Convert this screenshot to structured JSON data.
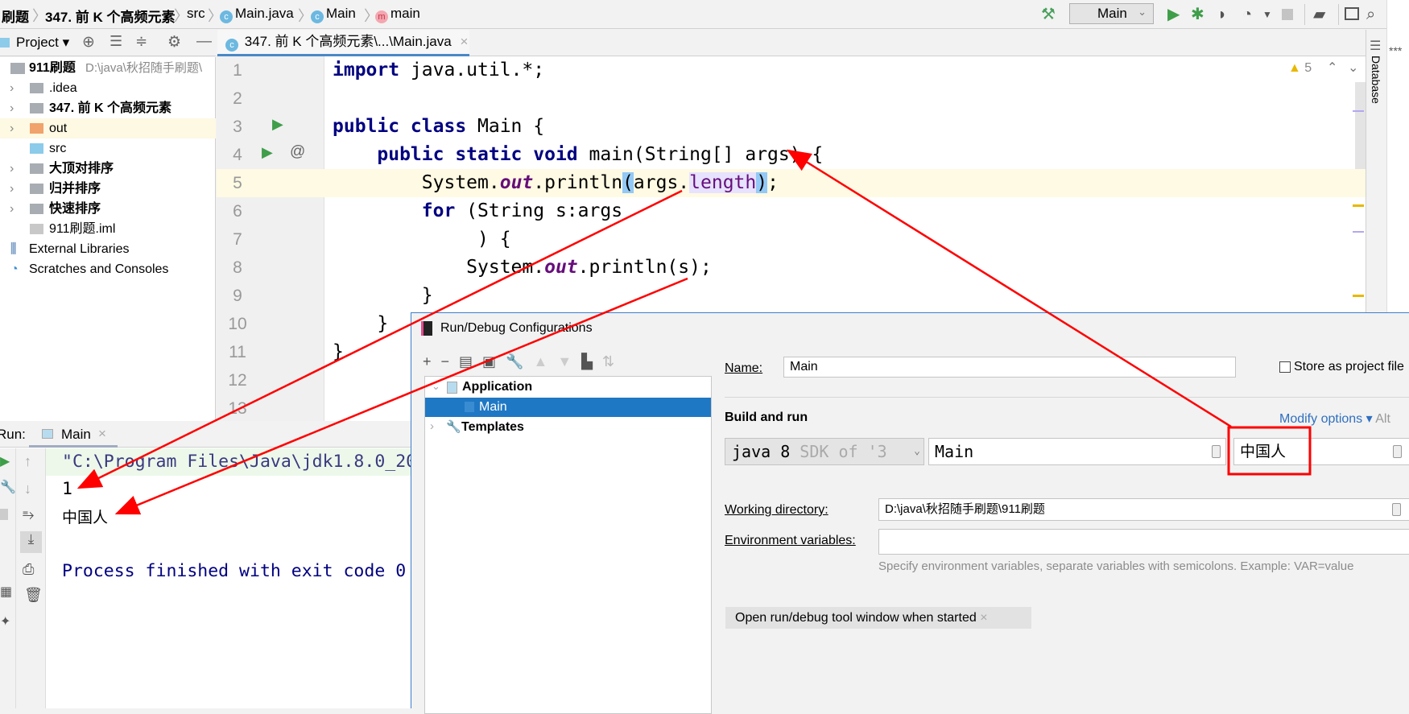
{
  "breadcrumb": {
    "items": [
      "刷题",
      "347. 前 K 个高频元素",
      "src",
      "Main.java",
      "Main",
      "main"
    ]
  },
  "toolbar": {
    "run_config": "Main",
    "icons": [
      "build-hammer-icon",
      "run-icon",
      "debug-icon",
      "coverage-icon",
      "profile-icon",
      "dropdown-icon",
      "stop-icon",
      "project-structure-icon",
      "terminal-icon",
      "search-icon"
    ]
  },
  "project_panel": {
    "title": "Project",
    "root": {
      "name": "911刷题",
      "path": "D:\\java\\秋招随手刷题\\"
    },
    "items": [
      {
        "label": ".idea",
        "bold": false,
        "color": "#a8adb3",
        "expandable": true
      },
      {
        "label": "347. 前 K 个高频元素",
        "bold": true,
        "color": "#a8adb3",
        "expandable": true
      },
      {
        "label": "out",
        "bold": false,
        "color": "#f0a36c",
        "expandable": true,
        "selected": true
      },
      {
        "label": "src",
        "bold": false,
        "color": "#8ccbea",
        "expandable": false
      },
      {
        "label": "大顶对排序",
        "bold": true,
        "color": "#a8adb3",
        "expandable": true
      },
      {
        "label": "归并排序",
        "bold": true,
        "color": "#a8adb3",
        "expandable": true
      },
      {
        "label": "快速排序",
        "bold": true,
        "color": "#a8adb3",
        "expandable": true
      },
      {
        "label": "911刷题.iml",
        "bold": false,
        "color": "#c8c8c8",
        "expandable": false
      }
    ],
    "external_libraries": "External Libraries",
    "scratches": "Scratches and Consoles"
  },
  "editor": {
    "tab_label": "347. 前 K 个高频元素\\...\\Main.java",
    "warnings": "5",
    "side_tool": "Database",
    "lines": [
      [
        {
          "t": "import",
          "k": "kw"
        },
        {
          "t": " java.util.*;",
          "k": ""
        }
      ],
      [],
      [
        {
          "t": "public class",
          "k": "kw"
        },
        {
          "t": " Main {",
          "k": ""
        }
      ],
      [
        {
          "t": "    "
        },
        {
          "t": "public static void",
          "k": "kw"
        },
        {
          "t": " main(String[] args) {",
          "k": ""
        }
      ],
      [
        {
          "t": "        System."
        },
        {
          "t": "out",
          "k": "fld"
        },
        {
          "t": ".println"
        },
        {
          "t": "(",
          "k": "brace"
        },
        {
          "t": "args."
        },
        {
          "t": "length",
          "k": "prop"
        },
        {
          "t": ")",
          "k": "brace"
        },
        {
          "t": ";"
        }
      ],
      [
        {
          "t": "        "
        },
        {
          "t": "for",
          "k": "kw"
        },
        {
          "t": " (String s:args"
        }
      ],
      [
        {
          "t": "             ) {"
        }
      ],
      [
        {
          "t": "            System."
        },
        {
          "t": "out",
          "k": "fld"
        },
        {
          "t": ".println(s);"
        }
      ],
      [
        {
          "t": "        }"
        }
      ],
      [
        {
          "t": "    }"
        }
      ],
      [
        {
          "t": "}"
        }
      ],
      [],
      []
    ]
  },
  "run_panel": {
    "label": "Run:",
    "tab": "Main",
    "console": {
      "command": "\"C:\\Program Files\\Java\\jdk1.8.0_20",
      "output1": "1",
      "output2": "中国人",
      "finished": "Process finished with exit code 0"
    }
  },
  "dialog": {
    "title": "Run/Debug Configurations",
    "tree": {
      "application": "Application",
      "main": "Main",
      "templates": "Templates"
    },
    "name_label": "Name:",
    "name_value": "Main",
    "store_as_project": "Store as project file",
    "section": "Build and run",
    "modify_options": "Modify options",
    "modify_shortcut": "Alt",
    "jre": "java 8",
    "jre_hint": "SDK of '3",
    "main_class": "Main",
    "program_args": "中国人",
    "working_dir_label": "Working directory:",
    "working_dir": "D:\\java\\秋招随手刷题\\911刷题",
    "env_label": "Environment variables:",
    "env_value": "",
    "env_hint": "Specify environment variables, separate variables with semicolons. Example: VAR=value",
    "chip": "Open run/debug tool window when started"
  },
  "annotation_color": "#ff0000"
}
